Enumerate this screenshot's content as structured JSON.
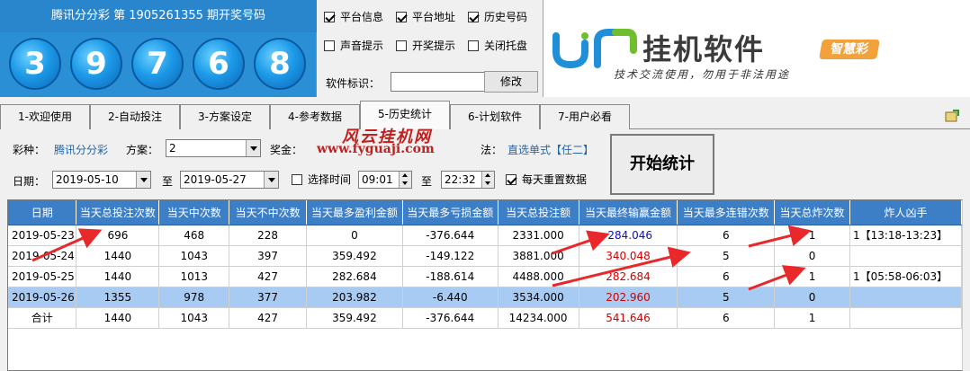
{
  "lottery": {
    "title": "腾讯分分彩 第 1905261355 期开奖号码",
    "balls": [
      "3",
      "9",
      "7",
      "6",
      "8"
    ]
  },
  "options": {
    "platform_info": "平台信息",
    "platform_addr": "平台地址",
    "history_numbers": "历史号码",
    "sound_tip": "声音提示",
    "draw_tip": "开奖提示",
    "close_tray": "关闭托盘",
    "ident_label": "软件标识：",
    "modify_button": "修改"
  },
  "logo": {
    "name": "挂机软件",
    "badge": "智慧彩",
    "slogan": "技术交流使用，勿用于非法用途"
  },
  "tabs": [
    "1-欢迎使用",
    "2-自动投注",
    "3-方案设定",
    "4-参考数据",
    "5-历史统计",
    "6-计划软件",
    "7-用户必看"
  ],
  "active_tab_index": 4,
  "filters": {
    "lottery_label": "彩种：",
    "lottery_value": "腾讯分分彩",
    "scheme_label": "方案：",
    "scheme_value": "2",
    "bonus_label": "奖金：",
    "method_label": "法：",
    "method_value": "直选单式【任二】",
    "date_label": "日期：",
    "date_from": "2019-05-10",
    "to_label": "至",
    "date_to": "2019-05-27",
    "select_time_label": "选择时间",
    "time_from": "09:01",
    "time_to_label": "至",
    "time_to": "22:32",
    "daily_reset_label": "每天重置数据",
    "start_button": "开始统计",
    "watermark_cn": "风云挂机网",
    "watermark_url": "www.fyguaji.com"
  },
  "table": {
    "headers": [
      "日期",
      "当天总投注次数",
      "当天中次数",
      "当天不中次数",
      "当天最多盈利金额",
      "当天最多亏损金额",
      "当天总投注额",
      "当天最终输赢金额",
      "当天最多连错次数",
      "当天总炸次数",
      "炸人凶手"
    ],
    "rows": [
      [
        "2019-05-23",
        "696",
        "468",
        "228",
        "0",
        "-376.644",
        "2331.000",
        "-284.046",
        "6",
        "1",
        "1【13:18-13:23】"
      ],
      [
        "2019-05-24",
        "1440",
        "1043",
        "397",
        "359.492",
        "-149.122",
        "3881.000",
        "340.048",
        "5",
        "0",
        ""
      ],
      [
        "2019-05-25",
        "1440",
        "1013",
        "427",
        "282.684",
        "-188.614",
        "4488.000",
        "282.684",
        "6",
        "1",
        "1【05:58-06:03】"
      ],
      [
        "2019-05-26",
        "1355",
        "978",
        "377",
        "203.982",
        "-6.440",
        "3534.000",
        "202.960",
        "5",
        "0",
        ""
      ],
      [
        "合计",
        "1440",
        "1043",
        "427",
        "359.492",
        "-376.644",
        "14234.000",
        "541.646",
        "6",
        "1",
        ""
      ]
    ],
    "selected_row": 3,
    "negative_result_color": "#1010b0",
    "positive_result_color": "#d00000"
  },
  "colors": {
    "header_bg": "#3d7fc7",
    "ball_blue": "#1d9ae8",
    "arrow_red": "#e8282a"
  }
}
